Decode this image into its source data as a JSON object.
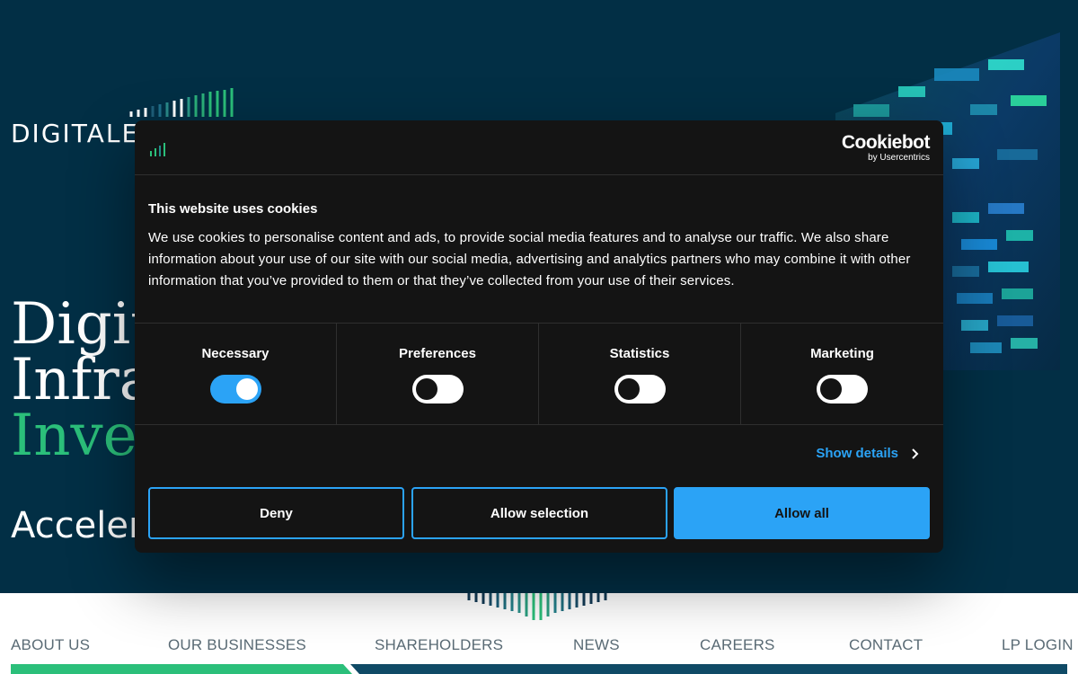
{
  "brand": {
    "logo_text": "DIGITALE"
  },
  "hero": {
    "title_line1": "Digit",
    "title_line2": "Infras",
    "title_line3": "Inves",
    "subtitle": "Accelera",
    "accent_color": "#2bbf7a",
    "background_color": "#022f45"
  },
  "nav": {
    "items": [
      {
        "label": "ABOUT US"
      },
      {
        "label": "OUR BUSINESSES"
      },
      {
        "label": "SHAREHOLDERS"
      },
      {
        "label": "NEWS"
      },
      {
        "label": "CAREERS"
      },
      {
        "label": "CONTACT"
      },
      {
        "label": "LP LOGIN"
      }
    ]
  },
  "cookie_dialog": {
    "provider_name": "Cookiebot",
    "provider_by": "by Usercentrics",
    "title": "This website uses cookies",
    "text": "We use cookies to personalise content and ads, to provide social media features and to analyse our traffic. We also share information about your use of our site with our social media, advertising and analytics partners who may combine it with other information that you’ve provided to them or that they’ve collected from your use of their services.",
    "categories": [
      {
        "label": "Necessary",
        "enabled": true
      },
      {
        "label": "Preferences",
        "enabled": false
      },
      {
        "label": "Statistics",
        "enabled": false
      },
      {
        "label": "Marketing",
        "enabled": false
      }
    ],
    "show_details_label": "Show details",
    "buttons": {
      "deny": "Deny",
      "allow_selection": "Allow selection",
      "allow_all": "Allow all"
    },
    "accent_color": "#2ba3f6",
    "background_color": "#141414"
  }
}
